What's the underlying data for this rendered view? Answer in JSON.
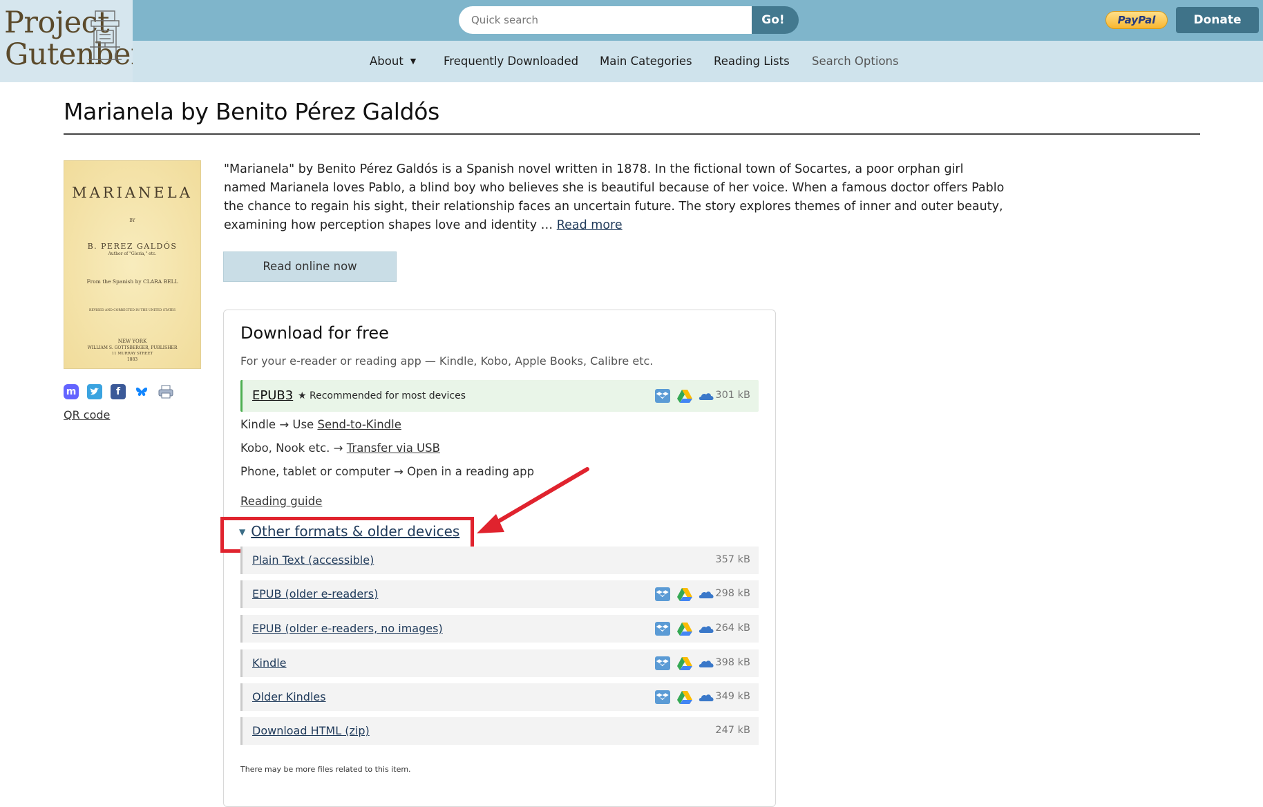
{
  "header": {
    "logo_line1": "Project",
    "logo_line2": "Gutenberg",
    "search_placeholder": "Quick search",
    "search_button": "Go!",
    "paypal_label": "PayPal",
    "donate_label": "Donate"
  },
  "nav": {
    "items": [
      "About",
      "Frequently Downloaded",
      "Main Categories",
      "Reading Lists",
      "Search Options"
    ],
    "about_caret": "▼"
  },
  "book": {
    "title": "Marianela by Benito Pérez Galdós",
    "cover": {
      "title": "MARIANELA",
      "by": "BY",
      "author": "B. PEREZ GALDÓS",
      "author_sub": "Author of \"Gloria,\" etc.",
      "translator": "From the Spanish by CLARA BELL",
      "revised": "REVISED AND CORRECTED IN THE UNITED STATES",
      "city": "NEW YORK",
      "publisher": "WILLIAM S. GOTTSBERGER, PUBLISHER",
      "address": "11 MURRAY STREET",
      "year": "1883"
    },
    "qr_code_label": "QR code",
    "description": "\"Marianela\" by Benito Pérez Galdós is a Spanish novel written in 1878. In the fictional town of Socartes, a poor orphan girl named Marianela loves Pablo, a blind boy who believes she is beautiful because of her voice. When a famous doctor offers Pablo the chance to regain his sight, their relationship faces an uncertain future. The story explores themes of inner and outer beauty, examining how perception shapes love and identity …",
    "read_more": "Read more",
    "read_online": "Read online now"
  },
  "download": {
    "title": "Download for free",
    "subtitle": "For your e-reader or reading app — Kindle, Kobo, Apple Books, Calibre etc.",
    "epub3": {
      "label": "EPUB3",
      "recommended": "★ Recommended for most devices",
      "size": "301 kB"
    },
    "kindle_prefix": "Kindle → Use ",
    "kindle_link": "Send-to-Kindle",
    "kobo_prefix": "Kobo, Nook etc. → ",
    "kobo_link": "Transfer via USB",
    "phone_text": "Phone, tablet or computer → Open in a reading app",
    "reading_guide": "Reading guide",
    "other_formats_toggle": "▼",
    "other_formats": "Other formats & older devices",
    "formats": [
      {
        "label": "Plain Text (accessible)",
        "size": "357 kB",
        "cloud": false
      },
      {
        "label": "EPUB (older e-readers)",
        "size": "298 kB",
        "cloud": true
      },
      {
        "label": "EPUB (older e-readers, no images)",
        "size": "264 kB",
        "cloud": true
      },
      {
        "label": "Kindle",
        "size": "398 kB",
        "cloud": true
      },
      {
        "label": "Older Kindles",
        "size": "349 kB",
        "cloud": true
      },
      {
        "label": "Download HTML (zip)",
        "size": "247 kB",
        "cloud": false
      }
    ],
    "footnote": "There may be more files related to this item."
  },
  "icons": {
    "social": [
      "mastodon-icon",
      "twitter-icon",
      "facebook-icon",
      "bluesky-icon",
      "print-icon"
    ],
    "cloud": [
      "dropbox-icon",
      "google-drive-icon",
      "onedrive-icon"
    ]
  },
  "colors": {
    "topbar": "#7fb5cb",
    "navbar": "#cfe3ec",
    "donate": "#3f7389",
    "highlight": "#e0232e",
    "recommended_bg": "#e9f5e8",
    "recommended_border": "#4caf50"
  }
}
